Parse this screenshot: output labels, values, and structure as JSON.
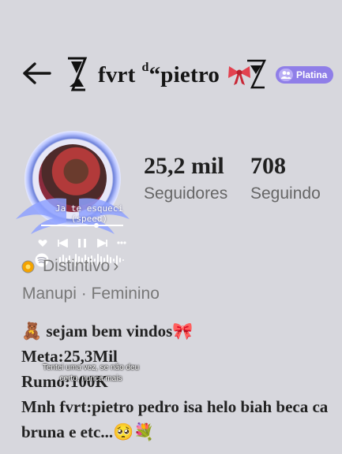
{
  "header": {
    "back_icon": "arrow-left-icon",
    "hourglass_icon": "hourglass-icon",
    "username": "fvrt",
    "username_sup": "d",
    "username_rest": "“pietro",
    "bow_icon": "bow-icon",
    "badge_label": "Platina",
    "badge_icon": "people-icon"
  },
  "profile": {
    "avatar_icon": "profile-avatar",
    "music": {
      "title": "Ja te esqueci (speed)",
      "progress": 0.64,
      "app_icon": "spotify-icon"
    },
    "stats": [
      {
        "value": "25,2 mil",
        "label": "Seguidores"
      },
      {
        "value": "708",
        "label": "Seguindo"
      }
    ],
    "category": "Distintivo",
    "gender": "Manupi · Feminino",
    "bio": [
      "🧸 sejam bem vindos🎀",
      "Meta:25,3Mil",
      "Rumo:100K",
      "Mnh fvrt:pietro pedro isa helo biah beca ca",
      "bruna e etc...🥺💐"
    ],
    "caption": "Tentei uma vez, se não deu certo, nunca mais"
  },
  "colors": {
    "background": "#d7d7dd",
    "badge": "#8f7ee8",
    "text": "#222222"
  }
}
